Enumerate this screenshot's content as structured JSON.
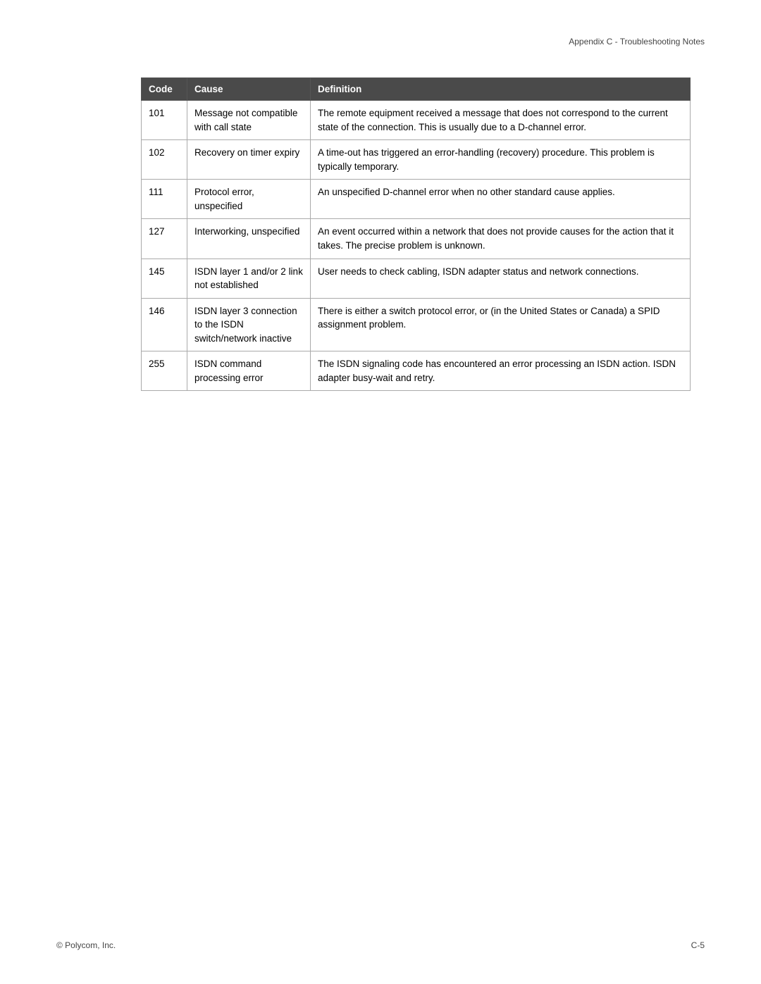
{
  "header": {
    "text": "Appendix C - Troubleshooting Notes"
  },
  "footer": {
    "left": "© Polycom, Inc.",
    "right": "C-5"
  },
  "table": {
    "columns": [
      {
        "key": "code",
        "label": "Code"
      },
      {
        "key": "cause",
        "label": "Cause"
      },
      {
        "key": "definition",
        "label": "Definition"
      }
    ],
    "rows": [
      {
        "code": "101",
        "cause": "Message not compatible with call state",
        "definition": "The remote equipment received a message that does not correspond to the current state of the connection. This is usually due to a D-channel error."
      },
      {
        "code": "102",
        "cause": "Recovery on timer expiry",
        "definition": "A time-out has triggered an error-handling (recovery) procedure. This problem is typically temporary."
      },
      {
        "code": "111",
        "cause": "Protocol error, unspecified",
        "definition": "An unspecified D-channel error when no other standard cause applies."
      },
      {
        "code": "127",
        "cause": "Interworking, unspecified",
        "definition": "An event occurred within a network that does not provide causes for the action that it takes. The precise problem is unknown."
      },
      {
        "code": "145",
        "cause": "ISDN layer 1 and/or 2 link not established",
        "definition": "User needs to check cabling, ISDN adapter status and network connections."
      },
      {
        "code": "146",
        "cause": "ISDN layer 3 connection to the ISDN switch/network inactive",
        "definition": "There is either a switch protocol error, or (in the United States or Canada) a SPID assignment problem."
      },
      {
        "code": "255",
        "cause": "ISDN command processing error",
        "definition": "The ISDN signaling code has encountered an error processing an ISDN action. ISDN adapter busy-wait and retry."
      }
    ]
  }
}
